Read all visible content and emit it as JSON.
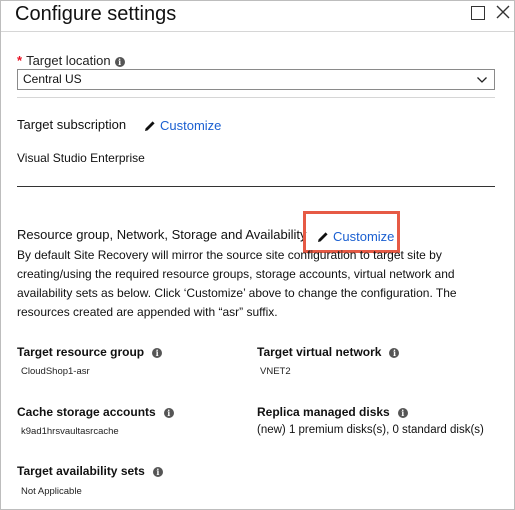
{
  "header": {
    "title": "Configure settings"
  },
  "target_location": {
    "label": "Target location",
    "value": "Central US"
  },
  "target_subscription": {
    "label": "Target subscription",
    "customize_label": "Customize",
    "value": "Visual Studio Enterprise"
  },
  "resources": {
    "heading": "Resource group, Network, Storage and Availability",
    "customize_label": "Customize",
    "description": "By default Site Recovery will mirror the source site configuration to target site by creating/using the required resource groups, storage accounts, virtual network and availability sets as below. Click ‘Customize’ above to change the configuration. The resources created are appended with “asr” suffix."
  },
  "fields": {
    "target_resource_group": {
      "label": "Target resource group",
      "value": "CloudShop1-asr"
    },
    "target_virtual_network": {
      "label": "Target virtual network",
      "value": "VNET2"
    },
    "cache_storage_accounts": {
      "label": "Cache storage accounts",
      "value": "k9ad1hrsvaultasrcache"
    },
    "replica_managed_disks": {
      "label": "Replica managed disks",
      "value": "(new) 1 premium disks(s), 0 standard disk(s)"
    },
    "target_availability_sets": {
      "label": "Target availability sets",
      "value": "Not Applicable"
    }
  },
  "colors": {
    "link": "#1a5fd1",
    "highlight": "#e65a45",
    "required": "#e81123"
  },
  "icons": [
    "maximize-icon",
    "close-icon",
    "info-icon",
    "chevron-down-icon",
    "pencil-icon"
  ]
}
